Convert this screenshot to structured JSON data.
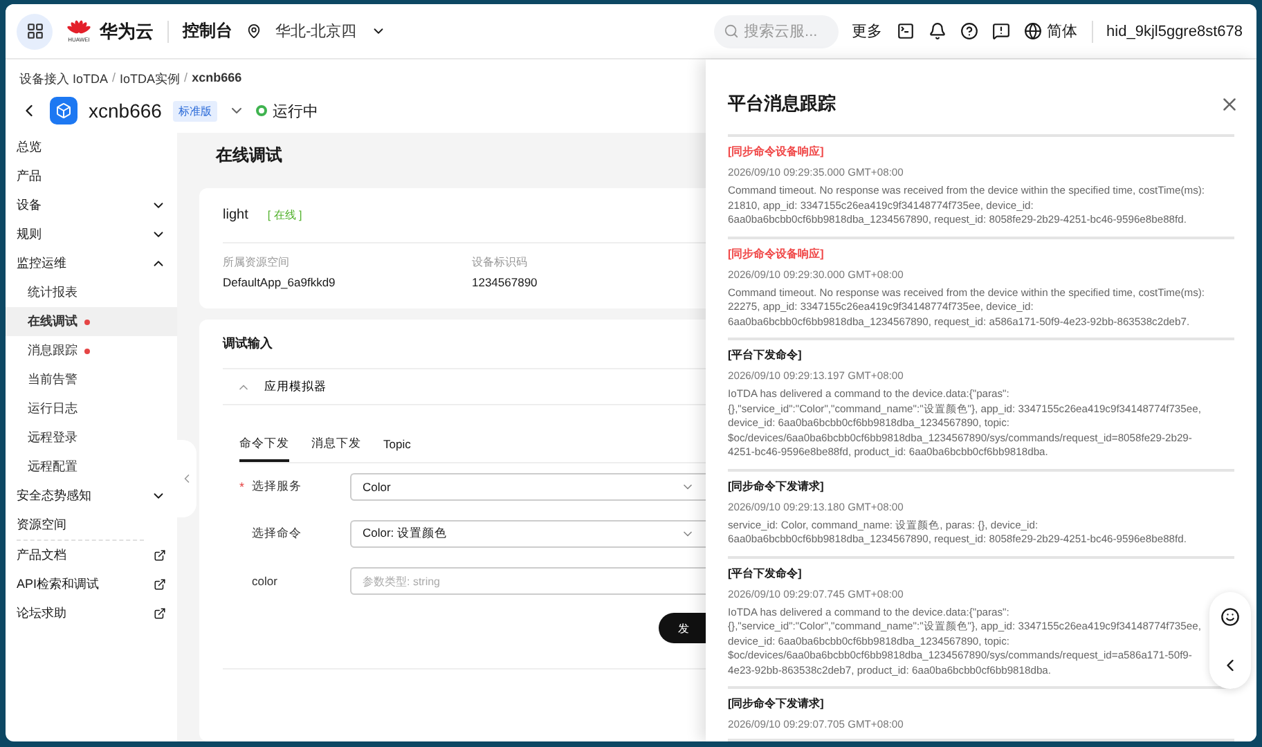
{
  "topbar": {
    "brand_mark": "HUAWEI",
    "brand": "华为云",
    "console": "控制台",
    "region": "华北-北京四",
    "search": {
      "placeholder": "搜索云服..."
    },
    "more": "更多",
    "language": "简体",
    "user": "hid_9kjl5ggre8st678"
  },
  "breadcrumb": [
    {
      "label": "设备接入 IoTDA",
      "current": false
    },
    {
      "separator": "/"
    },
    {
      "label": "IoTDA实例",
      "current": false
    },
    {
      "separator": "/"
    },
    {
      "label": "xcnb666",
      "current": true
    }
  ],
  "instance": {
    "name": "xcnb666",
    "edition": "标准版",
    "status": "运行中"
  },
  "sidebar": {
    "items": [
      {
        "label": "总览",
        "kind": "plain",
        "selected": false
      },
      {
        "label": "产品",
        "kind": "plain",
        "selected": false
      },
      {
        "label": "设备",
        "kind": "group",
        "expanded": false,
        "selected": false
      },
      {
        "label": "规则",
        "kind": "group",
        "expanded": false,
        "selected": false
      },
      {
        "label": "监控运维",
        "kind": "group",
        "expanded": true,
        "selected": false,
        "children": [
          {
            "label": "统计报表",
            "selected": false,
            "dot": false
          },
          {
            "label": "在线调试",
            "selected": true,
            "dot": true
          },
          {
            "label": "消息跟踪",
            "selected": false,
            "dot": true
          },
          {
            "label": "当前告警",
            "selected": false,
            "dot": false
          },
          {
            "label": "运行日志",
            "selected": false,
            "dot": false
          },
          {
            "label": "远程登录",
            "selected": false,
            "dot": false
          },
          {
            "label": "远程配置",
            "selected": false,
            "dot": false
          }
        ]
      },
      {
        "label": "安全态势感知",
        "kind": "group",
        "expanded": false,
        "selected": false
      },
      {
        "label": "资源空间",
        "kind": "plain",
        "selected": false
      },
      {
        "label": "产品文档",
        "kind": "link",
        "selected": false
      },
      {
        "label": "API检索和调试",
        "kind": "link",
        "selected": false
      },
      {
        "label": "论坛求助",
        "kind": "link",
        "selected": false
      }
    ]
  },
  "page_title": "在线调试",
  "device": {
    "name": "light",
    "status": "[ 在线 ]",
    "fields": [
      {
        "label": "所属资源空间",
        "value": "DefaultApp_6a9fkkd9"
      },
      {
        "label": "设备标识码",
        "value": "1234567890"
      }
    ]
  },
  "debug": {
    "title": "调试输入",
    "simulator": {
      "label": "应用模拟器",
      "expanded": true
    },
    "tabs": [
      {
        "label": "命令下发",
        "selected": true
      },
      {
        "label": "消息下发",
        "selected": false
      },
      {
        "label": "Topic",
        "selected": false
      }
    ],
    "required_mark": "*",
    "form": [
      {
        "label": "选择服务",
        "required": true,
        "kind": "select",
        "value": "Color"
      },
      {
        "label": "选择命令",
        "required": false,
        "kind": "select",
        "value": "Color: 设置颜色"
      },
      {
        "label": "color",
        "required": false,
        "kind": "input",
        "placeholder": "参数类型: string"
      }
    ],
    "send": "发"
  },
  "drawer": {
    "title": "平台消息跟踪",
    "entries": [
      {
        "kind": "response",
        "title": "[同步命令设备响应]",
        "time": "2026/09/10 09:29:35.000 GMT+08:00",
        "body": "Command timeout. No response was received from the device within the specified time, costTime(ms): 21810, app_id: 3347155c26ea419c9f34148774f735ee, device_id: 6aa0ba6bcbb0cf6bb9818dba_1234567890, request_id: 8058fe29-2b29-4251-bc46-9596e8be88fd."
      },
      {
        "kind": "response",
        "title": "[同步命令设备响应]",
        "time": "2026/09/10 09:29:30.000 GMT+08:00",
        "body": "Command timeout. No response was received from the device within the specified time, costTime(ms): 22275, app_id: 3347155c26ea419c9f34148774f735ee, device_id: 6aa0ba6bcbb0cf6bb9818dba_1234567890, request_id: a586a171-50f9-4e23-92bb-863538c2deb7."
      },
      {
        "kind": "command",
        "title": "[平台下发命令]",
        "time": "2026/09/10 09:29:13.197 GMT+08:00",
        "body": "IoTDA has delivered a command to the device.data:{\"paras\":{},\"service_id\":\"Color\",\"command_name\":\"设置颜色\"}, app_id: 3347155c26ea419c9f34148774f735ee, device_id: 6aa0ba6bcbb0cf6bb9818dba_1234567890, topic: $oc/devices/6aa0ba6bcbb0cf6bb9818dba_1234567890/sys/commands/request_id=8058fe29-2b29-4251-bc46-9596e8be88fd, product_id: 6aa0ba6bcbb0cf6bb9818dba."
      },
      {
        "kind": "command",
        "title": "[同步命令下发请求]",
        "time": "2026/09/10 09:29:13.180 GMT+08:00",
        "body": "service_id: Color, command_name: 设置颜色, paras: {}, device_id: 6aa0ba6bcbb0cf6bb9818dba_1234567890, request_id: 8058fe29-2b29-4251-bc46-9596e8be88fd."
      },
      {
        "kind": "command",
        "title": "[平台下发命令]",
        "time": "2026/09/10 09:29:07.745 GMT+08:00",
        "body": "IoTDA has delivered a command to the device.data:{\"paras\":{},\"service_id\":\"Color\",\"command_name\":\"设置颜色\"}, app_id: 3347155c26ea419c9f34148774f735ee, device_id: 6aa0ba6bcbb0cf6bb9818dba_1234567890, topic: $oc/devices/6aa0ba6bcbb0cf6bb9818dba_1234567890/sys/commands/request_id=a586a171-50f9-4e23-92bb-863538c2deb7, product_id: 6aa0ba6bcbb0cf6bb9818dba."
      },
      {
        "kind": "command",
        "title": "[同步命令下发请求]",
        "time": "2026/09/10 09:29:07.705 GMT+08:00"
      }
    ]
  }
}
